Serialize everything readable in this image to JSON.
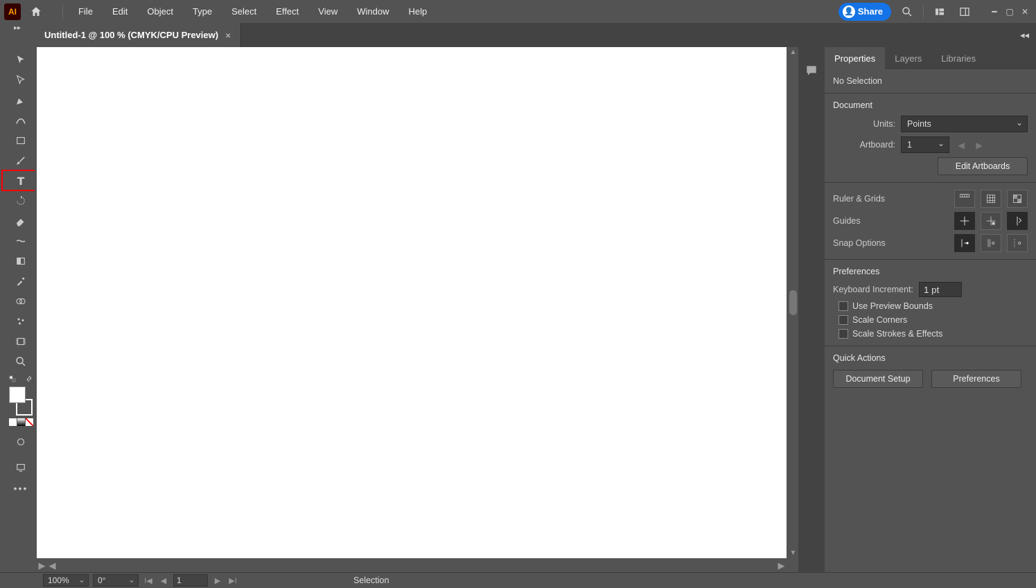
{
  "menubar": {
    "items": [
      "File",
      "Edit",
      "Object",
      "Type",
      "Select",
      "Effect",
      "View",
      "Window",
      "Help"
    ],
    "share": "Share"
  },
  "tab": {
    "title": "Untitled-1 @ 100 % (CMYK/CPU Preview)"
  },
  "panels": {
    "tabs": [
      "Properties",
      "Layers",
      "Libraries"
    ],
    "noSelection": "No Selection",
    "document": "Document",
    "unitsLabel": "Units:",
    "unitsValue": "Points",
    "artboardLabel": "Artboard:",
    "artboardValue": "1",
    "editArtboards": "Edit Artboards",
    "rulerGrids": "Ruler & Grids",
    "guides": "Guides",
    "snap": "Snap Options",
    "preferences": "Preferences",
    "keyIncrLabel": "Keyboard Increment:",
    "keyIncrValue": "1 pt",
    "usePreview": "Use Preview Bounds",
    "scaleCorners": "Scale Corners",
    "scaleStrokes": "Scale Strokes & Effects",
    "quickActions": "Quick Actions",
    "docSetup": "Document Setup",
    "prefBtn": "Preferences"
  },
  "status": {
    "zoom": "100%",
    "rotate": "0°",
    "artboard": "1",
    "tool": "Selection"
  }
}
